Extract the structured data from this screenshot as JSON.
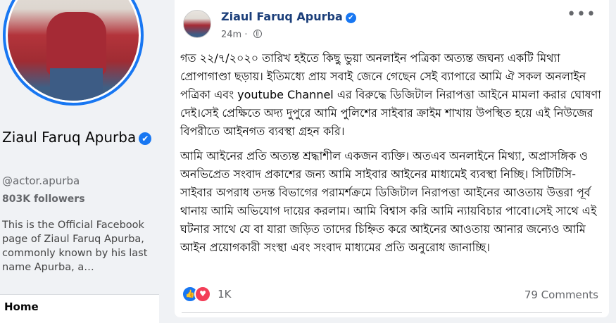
{
  "profile": {
    "name": "Ziaul Faruq Apurba",
    "handle": "@actor.apurba",
    "followers": "803K followers",
    "about": "This is the Official Facebook page of Ziaul Faruq Apurba, commonly known by his last name Apurba, a…",
    "nav_home": "Home"
  },
  "post": {
    "author": "Ziaul Faruq Apurba",
    "time": "24m",
    "paragraphs": [
      "গত ২২/৭/২০২০ তারিখ হইতে কিছু ভুয়া অনলাইন পত্রিকা অত্যন্ত জঘন্য একটি মিথ্যা প্রোপাগাণ্ডা ছড়ায়। ইতিমধ্যে প্রায় সবাই জেনে গেছেন সেই ব্যাপারে আমি ঐ সকল অনলাইন পত্রিকা এবং youtube Channel এর বিরুদ্ধে ডিজিটাল নিরাপত্তা আইনে মামলা করার ঘোষণা দেই।সেই প্রেক্ষিতে অদ্য দুপুরে আমি পুলিশের সাইবার ক্রাইম শাখায় উপস্থিত হয়ে এই নিউজের বিপরীতে আইনগত ব্যবস্থা গ্রহন করি।",
      "আমি আইনের প্রতি অত্যন্ত শ্রদ্ধাশীল একজন ব্যক্তি। অতএব অনলাইনে মিথ্যা, অপ্রাসঙ্গিক ও অনভিপ্রেত সংবাদ প্রকাশের জন্য আমি সাইবার আইনের মাধ্যমেই ব্যবস্থা নিচ্ছি। সিটিটিসি-সাইবার অপরাধ তদন্ত বিভাগের পরামর্শক্রমে ডিজিটাল নিরাপত্তা আইনের আওতায় উত্তরা পূর্ব থানায় আমি অভিযোগ দায়ের করলাম। আমি বিশ্বাস করি আমি ন্যায়বিচার পাবো।সেই সাথে এই ঘটনার সাথে যে বা যারা জড়িত তাদের চিহ্নিত করে আইনের আওতায় আনার জন্যেও আমি আইন প্রয়োগকারী সংস্থা এবং সংবাদ মাধ্যমের প্রতি অনুরোধ জানাচ্ছি।"
    ],
    "reactions_count": "1K",
    "comments_count": "79 Comments"
  },
  "icons": {
    "verified": "✔",
    "more": "•••",
    "like": "👍",
    "love": "♥"
  },
  "colors": {
    "accent": "#1877f2",
    "author_link": "#1c3f7a",
    "love": "#f33e58",
    "background": "#f0f2f5"
  }
}
